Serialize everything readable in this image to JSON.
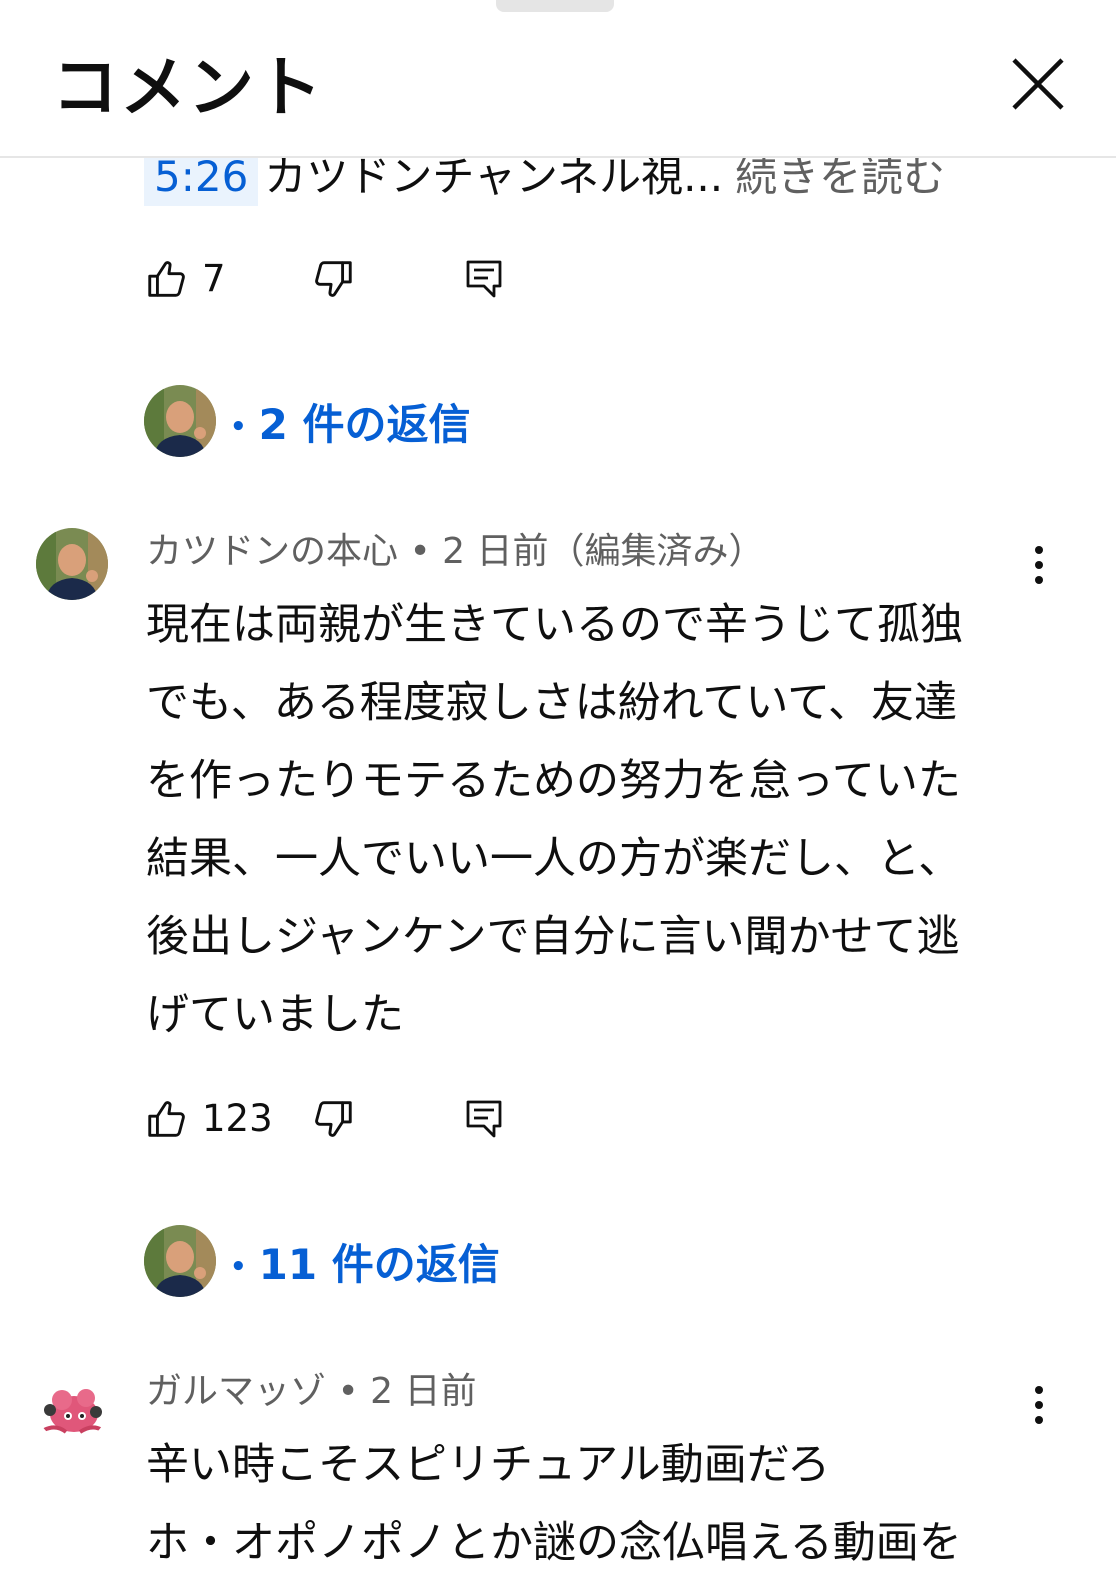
{
  "header": {
    "title": "コメント"
  },
  "top_comment": {
    "timestamp": "5:26",
    "snippet": "カツドンチャンネル視...",
    "read_more": "続きを読む",
    "like_count": "7",
    "replies": "2 件の返信"
  },
  "comments": [
    {
      "author": "カツドンの本心",
      "time": "2 日前",
      "edited": "（編集済み）",
      "lines": [
        "現在は両親が生きているので辛うじて孤独",
        "でも、ある程度寂しさは紛れていて、友達",
        "を作ったりモテるための努力を怠っていた",
        "結果、一人でいい一人の方が楽だし、と、",
        "後出しジャンケンで自分に言い聞かせて逃",
        "げていました"
      ],
      "like_count": "123",
      "replies": "11 件の返信"
    },
    {
      "author": "ガルマッゾ",
      "time": "2 日前",
      "lines": [
        "辛い時こそスピリチュアル動画だろ",
        "ホ・オポノポノとか謎の念仏唱える動画を"
      ]
    }
  ],
  "separator": "•",
  "colors": {
    "link_blue": "#065fd4",
    "secondary_text": "#606060",
    "timestamp_bg": "#eaf3fd"
  },
  "icons": [
    "close-icon",
    "thumbs-up-icon",
    "thumbs-down-icon",
    "reply-icon",
    "more-vert-icon",
    "avatar"
  ]
}
